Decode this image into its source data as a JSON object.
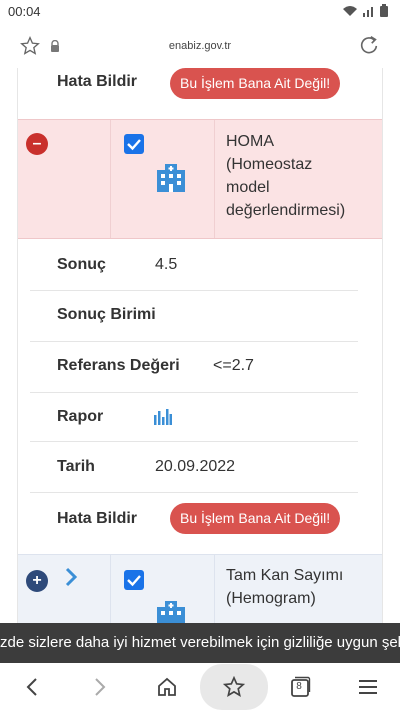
{
  "status_bar": {
    "time": "00:04"
  },
  "browser": {
    "url": "enabiz.gov.tr"
  },
  "top_row": {
    "label": "Hata Bildir",
    "button": "Bu İşlem Bana Ait Değil!"
  },
  "homa": {
    "name_lines": [
      "HOMA",
      "(Homeostaz",
      "model",
      "değerlendirmesi)"
    ],
    "collapse_symbol": "–",
    "details": {
      "sonuc": {
        "label": "Sonuç",
        "value": "4.5"
      },
      "sonuc_birimi": {
        "label": "Sonuç Birimi",
        "value": ""
      },
      "referans": {
        "label": "Referans Değeri",
        "value": "<=2.7"
      },
      "rapor": {
        "label": "Rapor"
      },
      "tarih": {
        "label": "Tarih",
        "value": "20.09.2022"
      },
      "hata": {
        "label": "Hata Bildir",
        "button": "Bu İşlem Bana Ait Değil!"
      }
    }
  },
  "hemogram": {
    "name_lines": [
      "Tam Kan Sayımı",
      "(Hemogram)"
    ],
    "expand_symbol": "+"
  },
  "cookie_banner": {
    "text": "zde sizlere daha iyi hizmet verebilmek için gizliliğe uygun şek"
  },
  "bottom_nav": {
    "tabs_count": "8"
  },
  "colors": {
    "danger": "#d9534f",
    "highlight_row": "#fbe3e4",
    "checkbox": "#1a73e8",
    "hospital_icon": "#3b8fd6"
  }
}
